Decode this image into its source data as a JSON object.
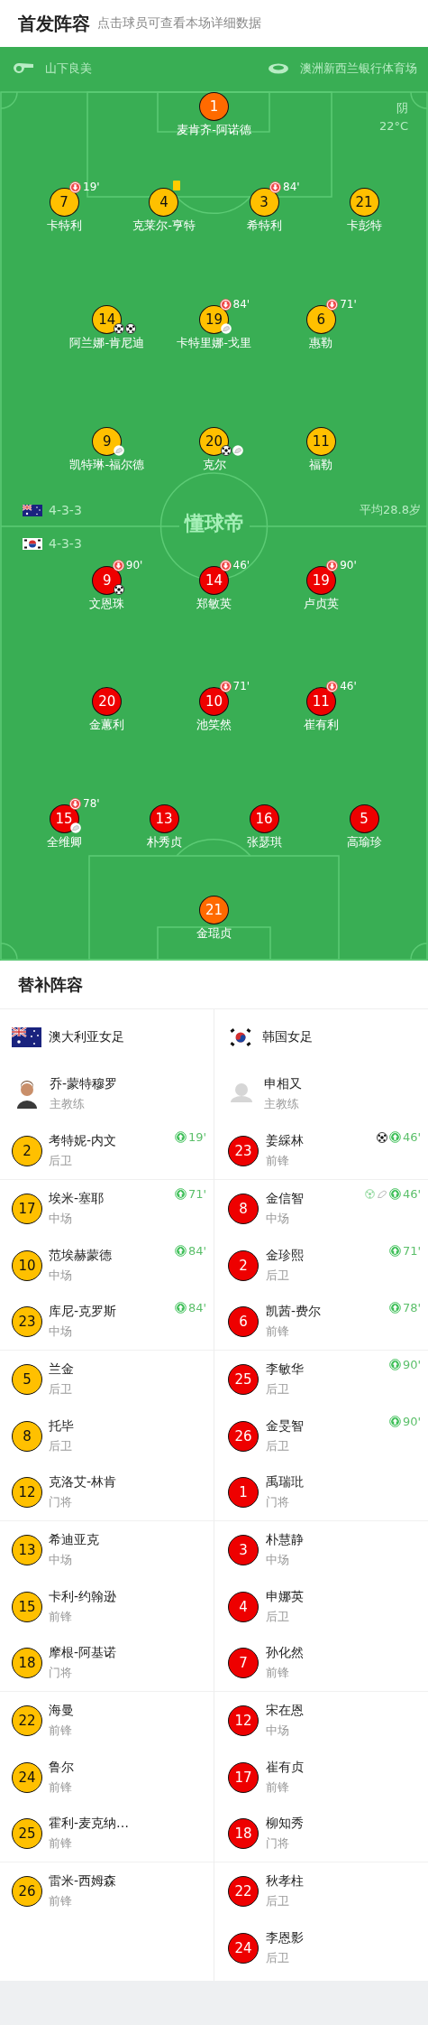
{
  "header": {
    "title": "首发阵容",
    "hint": "点击球员可查看本场详细数据"
  },
  "pitch": {
    "referee": "山下良美",
    "venue": "澳洲新西兰银行体育场",
    "weather": "阴",
    "temperature": "22°C",
    "logo": "懂球帝",
    "teams": [
      {
        "formation": "4-3-3",
        "average_age": "平均28.8岁",
        "color": "#ffc000",
        "lines": [
          [
            {
              "number": "1",
              "name": "麦肯齐-阿诺德",
              "kind": "goalkeeper"
            }
          ],
          [
            {
              "number": "7",
              "name": "卡特利",
              "kind": "outfield",
              "marks": [
                {
                  "kind": "sub_off",
                  "minute": "19'"
                }
              ]
            },
            {
              "number": "4",
              "name": "克莱尔-亨特",
              "kind": "outfield",
              "marks": [
                {
                  "kind": "yellow_card"
                }
              ]
            },
            {
              "number": "3",
              "name": "希特利",
              "kind": "outfield",
              "marks": [
                {
                  "kind": "sub_off",
                  "minute": "84'"
                }
              ]
            },
            {
              "number": "21",
              "name": "卡彭特",
              "kind": "outfield"
            }
          ],
          [
            {
              "number": "14",
              "name": "阿兰娜-肯尼迪",
              "kind": "outfield",
              "marks": [
                {
                  "kind": "goal"
                },
                {
                  "kind": "goal"
                }
              ]
            },
            {
              "number": "19",
              "name": "卡特里娜-戈里",
              "kind": "outfield",
              "marks": [
                {
                  "kind": "sub_off",
                  "minute": "84'"
                },
                {
                  "kind": "assist"
                }
              ]
            },
            {
              "number": "6",
              "name": "惠勒",
              "kind": "outfield",
              "marks": [
                {
                  "kind": "sub_off",
                  "minute": "71'"
                }
              ]
            }
          ],
          [
            {
              "number": "9",
              "name": "凯特琳-福尔德",
              "kind": "outfield",
              "marks": [
                {
                  "kind": "assist"
                }
              ]
            },
            {
              "number": "20",
              "name": "克尔",
              "kind": "outfield",
              "marks": [
                {
                  "kind": "goal"
                },
                {
                  "kind": "assist"
                }
              ]
            },
            {
              "number": "11",
              "name": "福勒",
              "kind": "outfield"
            }
          ]
        ]
      },
      {
        "formation": "4-3-3",
        "color": "#ee0000",
        "lines": [
          [
            {
              "number": "9",
              "name": "文恩珠",
              "kind": "outfield",
              "marks": [
                {
                  "kind": "sub_off",
                  "minute": "90'"
                },
                {
                  "kind": "goal"
                }
              ]
            },
            {
              "number": "14",
              "name": "郑敏英",
              "kind": "outfield",
              "marks": [
                {
                  "kind": "sub_off",
                  "minute": "46'"
                }
              ]
            },
            {
              "number": "19",
              "name": "卢贞英",
              "kind": "outfield",
              "marks": [
                {
                  "kind": "sub_off",
                  "minute": "90'"
                }
              ]
            }
          ],
          [
            {
              "number": "20",
              "name": "金蕙利",
              "kind": "outfield"
            },
            {
              "number": "10",
              "name": "池笑然",
              "kind": "outfield",
              "marks": [
                {
                  "kind": "sub_off",
                  "minute": "71'"
                }
              ]
            },
            {
              "number": "11",
              "name": "崔有利",
              "kind": "outfield",
              "marks": [
                {
                  "kind": "sub_off",
                  "minute": "46'"
                }
              ]
            }
          ],
          [
            {
              "number": "15",
              "name": "全维卿",
              "kind": "outfield",
              "marks": [
                {
                  "kind": "sub_off",
                  "minute": "78'"
                },
                {
                  "kind": "assist"
                }
              ]
            },
            {
              "number": "13",
              "name": "朴秀贞",
              "kind": "outfield"
            },
            {
              "number": "16",
              "name": "张瑟琪",
              "kind": "outfield"
            },
            {
              "number": "5",
              "name": "高瑜珍",
              "kind": "outfield"
            }
          ],
          [
            {
              "number": "21",
              "name": "金琨贞",
              "kind": "goalkeeper"
            }
          ]
        ]
      }
    ]
  },
  "substitutes": {
    "title": "替补阵容",
    "teams": [
      {
        "name": "澳大利亚女足",
        "color": "#ffc000",
        "coach": {
          "name": "乔-蒙特穆罗",
          "role": "主教练",
          "kind": "photo"
        },
        "players": [
          {
            "number": "2",
            "name": "考特妮-内文",
            "position": "后卫",
            "marks": [
              {
                "kind": "sub_on",
                "minute": "19'"
              }
            ]
          },
          {
            "number": "17",
            "name": "埃米-塞耶",
            "position": "中场",
            "marks": [
              {
                "kind": "sub_on",
                "minute": "71'"
              }
            ]
          },
          {
            "number": "10",
            "name": "范埃赫蒙德",
            "position": "中场",
            "marks": [
              {
                "kind": "sub_on",
                "minute": "84'"
              }
            ]
          },
          {
            "number": "23",
            "name": "库尼-克罗斯",
            "position": "中场",
            "marks": [
              {
                "kind": "sub_on",
                "minute": "84'"
              }
            ]
          },
          {
            "number": "5",
            "name": "兰金",
            "position": "后卫"
          },
          {
            "number": "8",
            "name": "托毕",
            "position": "后卫"
          },
          {
            "number": "12",
            "name": "克洛艾-林肯",
            "position": "门将"
          },
          {
            "number": "13",
            "name": "希迪亚克",
            "position": "中场"
          },
          {
            "number": "15",
            "name": "卡利-约翰逊",
            "position": "前锋"
          },
          {
            "number": "18",
            "name": "摩根-阿基诺",
            "position": "门将"
          },
          {
            "number": "22",
            "name": "海曼",
            "position": "前锋"
          },
          {
            "number": "24",
            "name": "鲁尔",
            "position": "前锋"
          },
          {
            "number": "25",
            "name": "霍利-麦克纳…",
            "position": "前锋"
          },
          {
            "number": "26",
            "name": "雷米-西姆森",
            "position": "前锋"
          }
        ]
      },
      {
        "name": "韩国女足",
        "color": "#ee0000",
        "coach": {
          "name": "申相又",
          "role": "主教练",
          "kind": "placeholder"
        },
        "players": [
          {
            "number": "23",
            "name": "姜綵林",
            "position": "前锋",
            "marks": [
              {
                "kind": "goal"
              },
              {
                "kind": "sub_on",
                "minute": "46'"
              }
            ]
          },
          {
            "number": "8",
            "name": "金信智",
            "position": "中场",
            "marks": [
              {
                "kind": "goal_light"
              },
              {
                "kind": "assist"
              },
              {
                "kind": "sub_on",
                "minute": "46'"
              }
            ]
          },
          {
            "number": "2",
            "name": "金珍熙",
            "position": "后卫",
            "marks": [
              {
                "kind": "sub_on",
                "minute": "71'"
              }
            ]
          },
          {
            "number": "6",
            "name": "凯茜-费尔",
            "position": "前锋",
            "marks": [
              {
                "kind": "sub_on",
                "minute": "78'"
              }
            ]
          },
          {
            "number": "25",
            "name": "李敏华",
            "position": "后卫",
            "marks": [
              {
                "kind": "sub_on",
                "minute": "90'"
              }
            ]
          },
          {
            "number": "26",
            "name": "金旻智",
            "position": "后卫",
            "marks": [
              {
                "kind": "sub_on",
                "minute": "90'"
              }
            ]
          },
          {
            "number": "1",
            "name": "禹瑞玭",
            "position": "门将"
          },
          {
            "number": "3",
            "name": "朴慧静",
            "position": "中场"
          },
          {
            "number": "4",
            "name": "申娜英",
            "position": "后卫"
          },
          {
            "number": "7",
            "name": "孙化然",
            "position": "前锋"
          },
          {
            "number": "12",
            "name": "宋在恩",
            "position": "中场"
          },
          {
            "number": "17",
            "name": "崔有贞",
            "position": "前锋"
          },
          {
            "number": "18",
            "name": "柳知秀",
            "position": "门将"
          },
          {
            "number": "22",
            "name": "秋孝柱",
            "position": "后卫"
          },
          {
            "number": "24",
            "name": "李恩影",
            "position": "后卫"
          }
        ]
      }
    ]
  }
}
